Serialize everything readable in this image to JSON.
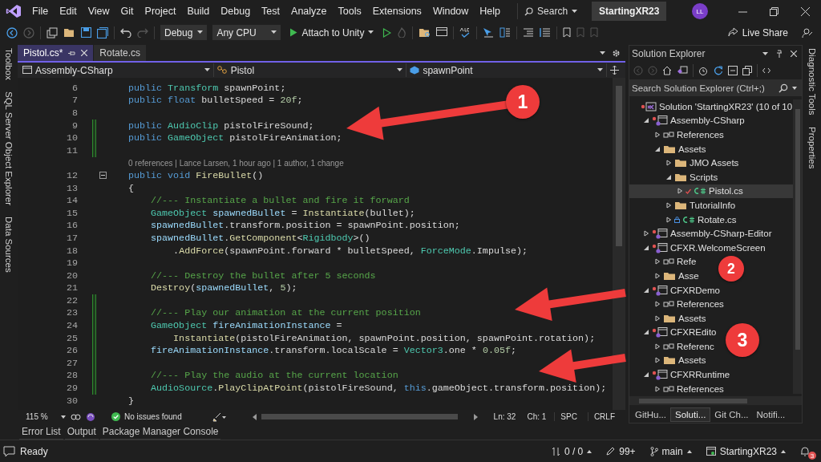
{
  "window": {
    "solution_name": "StartingXR23",
    "avatar": "LL"
  },
  "menu": [
    "File",
    "Edit",
    "View",
    "Git",
    "Project",
    "Build",
    "Debug",
    "Test",
    "Analyze",
    "Tools",
    "Extensions",
    "Window",
    "Help"
  ],
  "search": {
    "label": "Search"
  },
  "toolbar": {
    "configuration": "Debug",
    "platform": "Any CPU",
    "run_target": "Attach to Unity",
    "live_share": "Live Share"
  },
  "left_tool_tabs": [
    "Toolbox",
    "SQL Server Object Explorer",
    "Data Sources"
  ],
  "right_tool_tabs": [
    "Diagnostic Tools",
    "Properties"
  ],
  "editor": {
    "tabs": [
      {
        "label": "Pistol.cs*",
        "selected": true
      },
      {
        "label": "Rotate.cs",
        "selected": false
      }
    ],
    "nav": [
      "Assembly-CSharp",
      "Pistol",
      "spawnPoint"
    ],
    "lines": [
      {
        "kind": "code",
        "number": "6",
        "changed": false,
        "fold": false,
        "segments": [
          {
            "kind": "keyword",
            "t": "public "
          },
          {
            "kind": "type",
            "t": "Transform"
          },
          {
            "kind": "plain",
            "t": " spawnPoint;"
          }
        ]
      },
      {
        "kind": "code",
        "number": "7",
        "changed": false,
        "fold": false,
        "segments": [
          {
            "kind": "keyword",
            "t": "public "
          },
          {
            "kind": "keyword",
            "t": "float"
          },
          {
            "kind": "plain",
            "t": " bulletSpeed = "
          },
          {
            "kind": "number",
            "t": "20f"
          },
          {
            "kind": "plain",
            "t": ";"
          }
        ]
      },
      {
        "kind": "code",
        "number": "8",
        "changed": false,
        "fold": false
      },
      {
        "kind": "code",
        "number": "9",
        "changed": true,
        "fold": false,
        "segments": [
          {
            "kind": "keyword",
            "t": "public "
          },
          {
            "kind": "type",
            "t": "AudioClip"
          },
          {
            "kind": "plain",
            "t": " pistolFireSound;"
          }
        ]
      },
      {
        "kind": "code",
        "number": "10",
        "changed": true,
        "fold": false,
        "segments": [
          {
            "kind": "keyword",
            "t": "public "
          },
          {
            "kind": "type",
            "t": "GameObject"
          },
          {
            "kind": "plain",
            "t": " pistolFireAnimation;"
          }
        ]
      },
      {
        "kind": "code",
        "number": "11",
        "changed": true,
        "fold": false
      },
      {
        "kind": "codelens",
        "text": "0 references | Lance Larsen, 1 hour ago | 1 author, 1 change"
      },
      {
        "kind": "code",
        "number": "12",
        "changed": false,
        "fold": true,
        "segments": [
          {
            "kind": "keyword",
            "t": "public "
          },
          {
            "kind": "keyword",
            "t": "void"
          },
          {
            "kind": "method",
            "t": " FireBullet"
          },
          {
            "kind": "plain",
            "t": "()"
          }
        ]
      },
      {
        "kind": "code",
        "number": "13",
        "changed": false,
        "fold": false,
        "segments": [
          {
            "kind": "plain",
            "t": "{"
          }
        ]
      },
      {
        "kind": "code",
        "number": "14",
        "changed": false,
        "fold": false,
        "segments": [
          {
            "kind": "comment",
            "t": "    //--- Instantiate a bullet and fire it forward"
          }
        ]
      },
      {
        "kind": "code",
        "number": "15",
        "changed": false,
        "fold": false,
        "segments": [
          {
            "kind": "type",
            "t": "    GameObject"
          },
          {
            "kind": "local",
            "t": " spawnedBullet"
          },
          {
            "kind": "plain",
            "t": " = "
          },
          {
            "kind": "method",
            "t": "Instantiate"
          },
          {
            "kind": "plain",
            "t": "(bullet);"
          }
        ]
      },
      {
        "kind": "code",
        "number": "16",
        "changed": false,
        "fold": false,
        "segments": [
          {
            "kind": "local",
            "t": "    spawnedBullet"
          },
          {
            "kind": "plain",
            "t": ".transform.position = spawnPoint.position;"
          }
        ]
      },
      {
        "kind": "code",
        "number": "17",
        "changed": false,
        "fold": false,
        "segments": [
          {
            "kind": "local",
            "t": "    spawnedBullet"
          },
          {
            "kind": "plain",
            "t": "."
          },
          {
            "kind": "method",
            "t": "GetComponent"
          },
          {
            "kind": "plain",
            "t": "<"
          },
          {
            "kind": "type",
            "t": "Rigidbody"
          },
          {
            "kind": "plain",
            "t": ">()"
          }
        ]
      },
      {
        "kind": "code",
        "number": "18",
        "changed": false,
        "fold": false,
        "segments": [
          {
            "kind": "plain",
            "t": "        ."
          },
          {
            "kind": "method",
            "t": "AddForce"
          },
          {
            "kind": "plain",
            "t": "(spawnPoint.forward * bulletSpeed, "
          },
          {
            "kind": "type",
            "t": "ForceMode"
          },
          {
            "kind": "plain",
            "t": ".Impulse);"
          }
        ]
      },
      {
        "kind": "code",
        "number": "19",
        "changed": false,
        "fold": false
      },
      {
        "kind": "code",
        "number": "20",
        "changed": false,
        "fold": false,
        "segments": [
          {
            "kind": "comment",
            "t": "    //--- Destroy the bullet after 5 seconds"
          }
        ]
      },
      {
        "kind": "code",
        "number": "21",
        "changed": false,
        "fold": false,
        "segments": [
          {
            "kind": "method",
            "t": "    Destroy"
          },
          {
            "kind": "plain",
            "t": "("
          },
          {
            "kind": "local",
            "t": "spawnedBullet"
          },
          {
            "kind": "plain",
            "t": ", "
          },
          {
            "kind": "number",
            "t": "5"
          },
          {
            "kind": "plain",
            "t": ");"
          }
        ]
      },
      {
        "kind": "code",
        "number": "22",
        "changed": true,
        "fold": false
      },
      {
        "kind": "code",
        "number": "23",
        "changed": true,
        "fold": false,
        "segments": [
          {
            "kind": "comment",
            "t": "    //--- Play our animation at the current position"
          }
        ]
      },
      {
        "kind": "code",
        "number": "24",
        "changed": true,
        "fold": false,
        "segments": [
          {
            "kind": "type",
            "t": "    GameObject"
          },
          {
            "kind": "local",
            "t": " fireAnimationInstance"
          },
          {
            "kind": "plain",
            "t": " ="
          }
        ]
      },
      {
        "kind": "code",
        "number": "25",
        "changed": true,
        "fold": false,
        "segments": [
          {
            "kind": "method",
            "t": "        Instantiate"
          },
          {
            "kind": "plain",
            "t": "(pistolFireAnimation, spawnPoint.position, spawnPoint.rotation);"
          }
        ]
      },
      {
        "kind": "code",
        "number": "26",
        "changed": true,
        "fold": false,
        "segments": [
          {
            "kind": "local",
            "t": "    fireAnimationInstance"
          },
          {
            "kind": "plain",
            "t": ".transform.localScale = "
          },
          {
            "kind": "type",
            "t": "Vector3"
          },
          {
            "kind": "plain",
            "t": ".one * "
          },
          {
            "kind": "number",
            "t": "0.05f"
          },
          {
            "kind": "plain",
            "t": ";"
          }
        ]
      },
      {
        "kind": "code",
        "number": "27",
        "changed": true,
        "fold": false
      },
      {
        "kind": "code",
        "number": "28",
        "changed": true,
        "fold": false,
        "segments": [
          {
            "kind": "comment",
            "t": "    //--- Play the audio at the current location"
          }
        ]
      },
      {
        "kind": "code",
        "number": "29",
        "changed": true,
        "fold": false,
        "segments": [
          {
            "kind": "type",
            "t": "    AudioSource"
          },
          {
            "kind": "plain",
            "t": "."
          },
          {
            "kind": "method",
            "t": "PlayClipAtPoint"
          },
          {
            "kind": "plain",
            "t": "(pistolFireSound, "
          },
          {
            "kind": "keyword",
            "t": "this"
          },
          {
            "kind": "plain",
            "t": ".gameObject.transform.position);"
          }
        ]
      },
      {
        "kind": "code",
        "number": "30",
        "changed": false,
        "fold": false,
        "segments": [
          {
            "kind": "plain",
            "t": "}"
          }
        ]
      }
    ],
    "status": {
      "zoom": "115 %",
      "issues": "No issues found",
      "line": "Ln: 32",
      "column": "Ch: 1",
      "whitespace": "SPC",
      "line_endings": "CRLF"
    }
  },
  "solution_explorer": {
    "title": "Solution Explorer",
    "search": {
      "placeholder": "Search Solution Explorer (Ctrl+;)"
    },
    "tree": [
      {
        "kind": "solution",
        "label": "Solution 'StartingXR23' (10 of 10",
        "selected": false,
        "children": [
          {
            "kind": "project",
            "label": "Assembly-CSharp",
            "expanded": true,
            "selected": false,
            "children": [
              {
                "kind": "references",
                "label": "References",
                "expanded": false,
                "selected": false
              },
              {
                "kind": "folder",
                "label": "Assets",
                "expanded": true,
                "selected": false,
                "children": [
                  {
                    "kind": "folder",
                    "label": "JMO Assets",
                    "expanded": false,
                    "selected": false
                  },
                  {
                    "kind": "folder",
                    "label": "Scripts",
                    "expanded": true,
                    "selected": false,
                    "children": [
                      {
                        "kind": "file",
                        "label": "Pistol.cs",
                        "expanded": false,
                        "selected": true,
                        "edited": true,
                        "locked": false
                      }
                    ]
                  },
                  {
                    "kind": "folder",
                    "label": "TutorialInfo",
                    "expanded": false,
                    "selected": false
                  },
                  {
                    "kind": "file",
                    "label": "Rotate.cs",
                    "expanded": false,
                    "selected": false,
                    "edited": false,
                    "locked": true
                  }
                ]
              }
            ]
          },
          {
            "kind": "project",
            "label": "Assembly-CSharp-Editor",
            "expanded": false,
            "selected": false
          },
          {
            "kind": "project",
            "label": "CFXR.WelcomeScreen",
            "expanded": true,
            "selected": false,
            "children": [
              {
                "kind": "references",
                "label": "Refe",
                "expanded": false,
                "selected": false
              },
              {
                "kind": "folder",
                "label": "Asse",
                "expanded": false,
                "selected": false
              }
            ]
          },
          {
            "kind": "project",
            "label": "CFXRDemo",
            "expanded": true,
            "selected": false,
            "children": [
              {
                "kind": "references",
                "label": "References",
                "expanded": false,
                "selected": false
              },
              {
                "kind": "folder",
                "label": "Assets",
                "expanded": false,
                "selected": false
              }
            ]
          },
          {
            "kind": "project",
            "label": "CFXREdito",
            "expanded": true,
            "selected": false,
            "children": [
              {
                "kind": "references",
                "label": "Referenc",
                "expanded": false,
                "selected": false
              },
              {
                "kind": "folder",
                "label": "Assets",
                "expanded": false,
                "selected": false
              }
            ]
          },
          {
            "kind": "project",
            "label": "CFXRRuntime",
            "expanded": true,
            "selected": false,
            "children": [
              {
                "kind": "references",
                "label": "References",
                "expanded": false,
                "selected": false
              }
            ]
          }
        ]
      }
    ],
    "tabs": [
      {
        "label": "GitHu...",
        "selected": false
      },
      {
        "label": "Soluti...",
        "selected": true
      },
      {
        "label": "Git Ch...",
        "selected": false
      },
      {
        "label": "Notifi...",
        "selected": false
      }
    ]
  },
  "bottom_tabs": [
    "Error List",
    "Output",
    "Package Manager Console"
  ],
  "status_bar": {
    "text": "Ready",
    "changes": "0 / 0",
    "edits": "99+",
    "branch": "main",
    "repository": "StartingXR23",
    "notifications": "3"
  },
  "annotations": [
    {
      "label": "1"
    },
    {
      "label": "2"
    },
    {
      "label": "3"
    }
  ]
}
